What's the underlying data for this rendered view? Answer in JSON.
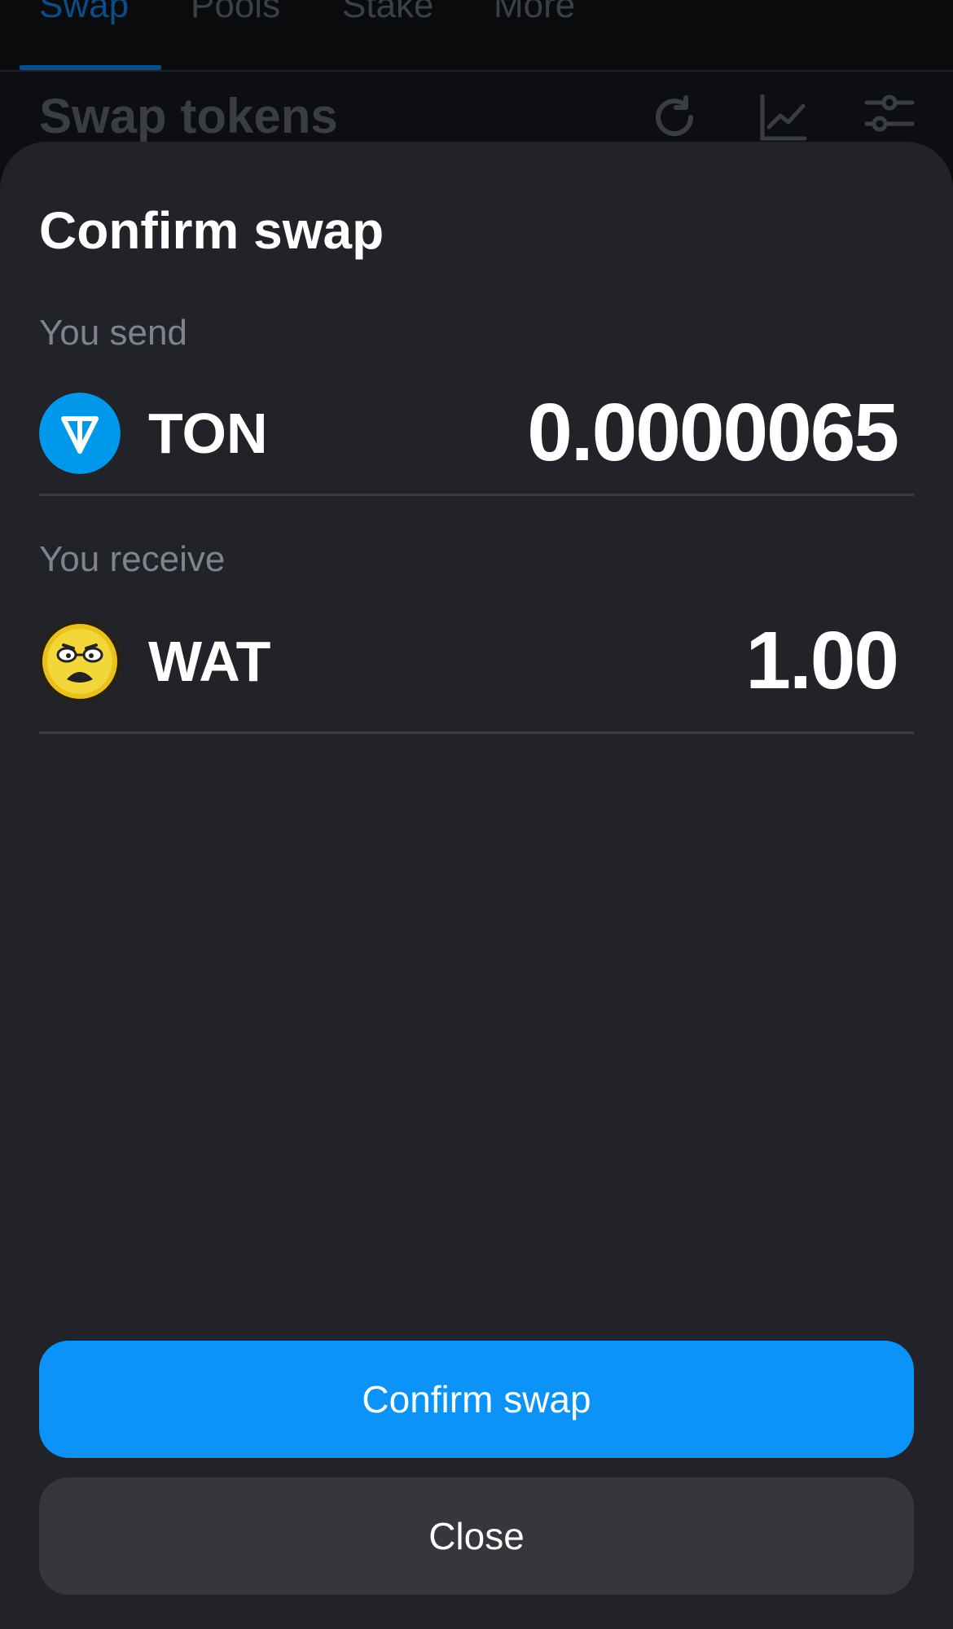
{
  "nav": {
    "tabs": [
      {
        "label": "Swap",
        "active": true
      },
      {
        "label": "Pools",
        "active": false
      },
      {
        "label": "Stake",
        "active": false
      },
      {
        "label": "More",
        "active": false
      }
    ]
  },
  "background": {
    "title": "Swap tokens",
    "icons": [
      "refresh-icon",
      "chart-icon",
      "settings-sliders-icon"
    ]
  },
  "modal": {
    "title": "Confirm swap",
    "send": {
      "label": "You send",
      "token": "TON",
      "amount": "0.0000065",
      "icon": "ton-logo-icon",
      "color": "#0098ea"
    },
    "receive": {
      "label": "You receive",
      "token": "WAT",
      "amount": "1.00",
      "icon": "wat-logo-icon",
      "color": "#e8c21b"
    },
    "confirm_label": "Confirm swap",
    "close_label": "Close"
  },
  "colors": {
    "accent": "#0b93f8",
    "sheet_bg": "#212328",
    "close_bg": "#35373d"
  }
}
